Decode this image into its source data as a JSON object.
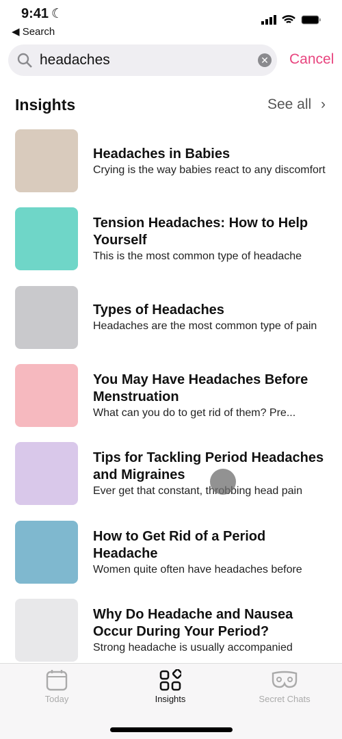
{
  "status": {
    "time": "9:41",
    "back": "◀ Search"
  },
  "search": {
    "value": "headaches",
    "cancel": "Cancel"
  },
  "section": {
    "title": "Insights",
    "see_all": "See all"
  },
  "items": [
    {
      "title": "Headaches in Babies",
      "subtitle": "Crying is the way babies react to any discomfort",
      "color": "#d9cbbd"
    },
    {
      "title": "Tension Headaches: How to Help Yourself",
      "subtitle": "This is the most common type of headache",
      "color": "#6fd6c8"
    },
    {
      "title": "Types of Headaches",
      "subtitle": "Headaches are the most common type of pain",
      "color": "#c9c9cc"
    },
    {
      "title": "You May Have Headaches Before Menstruation",
      "subtitle": "What can you do to get rid of them? Pre...",
      "color": "#f6b9bf"
    },
    {
      "title": "Tips for Tackling Period Headaches and Migraines",
      "subtitle": "Ever get that constant, throbbing head pain",
      "color": "#d9c8ea"
    },
    {
      "title": "How to Get Rid of a Period Headache",
      "subtitle": "Women quite often have headaches before",
      "color": "#7fb8cf"
    },
    {
      "title": "Why Do Headache and Nausea Occur During Your Period?",
      "subtitle": "Strong headache is usually accompanied",
      "color": "#e8e8ea"
    }
  ],
  "tabs": [
    {
      "label": "Today",
      "icon": "calendar-icon"
    },
    {
      "label": "Insights",
      "icon": "insights-icon",
      "active": true
    },
    {
      "label": "Secret Chats",
      "icon": "mask-icon"
    }
  ],
  "colors": {
    "accent": "#e8457f"
  }
}
